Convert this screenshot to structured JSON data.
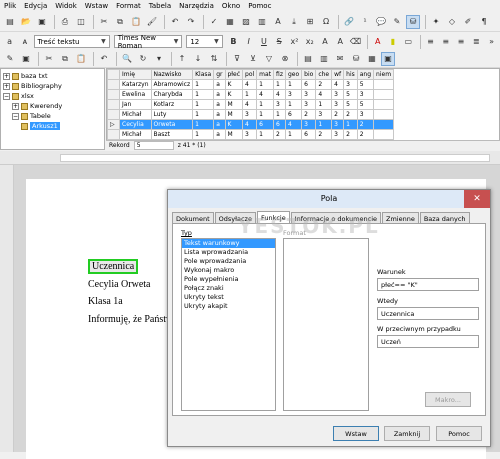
{
  "menu": [
    "Plik",
    "Edycja",
    "Widok",
    "Wstaw",
    "Format",
    "Tabela",
    "Narzędzia",
    "Okno",
    "Pomoc"
  ],
  "format_bar": {
    "style": "Treść tekstu",
    "font": "Times New Roman",
    "size": "12"
  },
  "tree": {
    "items": [
      {
        "label": "baza txt",
        "level": 0,
        "exp": "+"
      },
      {
        "label": "Bibliography",
        "level": 0,
        "exp": "+"
      },
      {
        "label": "xlsx",
        "level": 0,
        "exp": "−"
      },
      {
        "label": "Kwerendy",
        "level": 1,
        "exp": "+"
      },
      {
        "label": "Tabele",
        "level": 1,
        "exp": "−"
      },
      {
        "label": "Arkusz1",
        "level": 2,
        "exp": ""
      }
    ]
  },
  "grid": {
    "columns": [
      "Imię",
      "Nazwisko",
      "Klasa",
      "gr",
      "płeć",
      "pol",
      "mat",
      "fiz",
      "geo",
      "bio",
      "che",
      "wf",
      "his",
      "ang",
      "niem"
    ],
    "rows": [
      [
        "Katarzyn",
        "Abramowicz",
        "1",
        "a",
        "K",
        "4",
        "1",
        "1",
        "1",
        "6",
        "2",
        "4",
        "3",
        "5",
        ""
      ],
      [
        "Ewelina",
        "Charybda",
        "1",
        "a",
        "K",
        "1",
        "4",
        "4",
        "3",
        "3",
        "4",
        "3",
        "5",
        "3",
        ""
      ],
      [
        "Jan",
        "Kotlarz",
        "1",
        "a",
        "M",
        "4",
        "1",
        "3",
        "1",
        "3",
        "1",
        "3",
        "5",
        "5",
        ""
      ],
      [
        "Michał",
        "Luty",
        "1",
        "a",
        "M",
        "3",
        "1",
        "1",
        "6",
        "2",
        "3",
        "2",
        "2",
        "3",
        ""
      ],
      [
        "Cecylia",
        "Orweta",
        "1",
        "a",
        "K",
        "4",
        "6",
        "6",
        "4",
        "3",
        "1",
        "3",
        "1",
        "2",
        ""
      ],
      [
        "Michał",
        "Baszt",
        "1",
        "a",
        "M",
        "3",
        "1",
        "2",
        "1",
        "6",
        "2",
        "3",
        "2",
        "2",
        ""
      ]
    ],
    "highlight_row": 4
  },
  "record": {
    "label": "Rekord",
    "current": "5",
    "total": "z 41 * (1)"
  },
  "document": {
    "field": "Uczennica",
    "lines": [
      "Cecylia  Orweta",
      "Klasa 1a",
      "Informuję,  że  Państw"
    ]
  },
  "dialog": {
    "title": "Pola",
    "close": "✕",
    "tabs": [
      "Dokument",
      "Odsyłacze",
      "Funkcje",
      "Informacje o dokumencie",
      "Zmienne",
      "Baza danych"
    ],
    "active_tab": 2,
    "type_label": "Typ",
    "format_label": "Format",
    "types": [
      "Tekst warunkowy",
      "Lista wprowadzania",
      "Pole wprowadzania",
      "Wykonaj makro",
      "Pole wypełnienia",
      "Połącz znaki",
      "Ukryty tekst",
      "Ukryty akapit"
    ],
    "selected_type": 0,
    "condition_label": "Warunek",
    "condition_value": "płeć== \"K\"",
    "then_label": "Wtedy",
    "then_value": "Uczennica",
    "else_label": "W przeciwnym przypadku",
    "else_value": "Uczeń",
    "macro_button": "Makro...",
    "insert_button": "Wstaw",
    "close_button": "Zamknij",
    "help_button": "Pomoc"
  },
  "watermark": "YESTOK.PL"
}
